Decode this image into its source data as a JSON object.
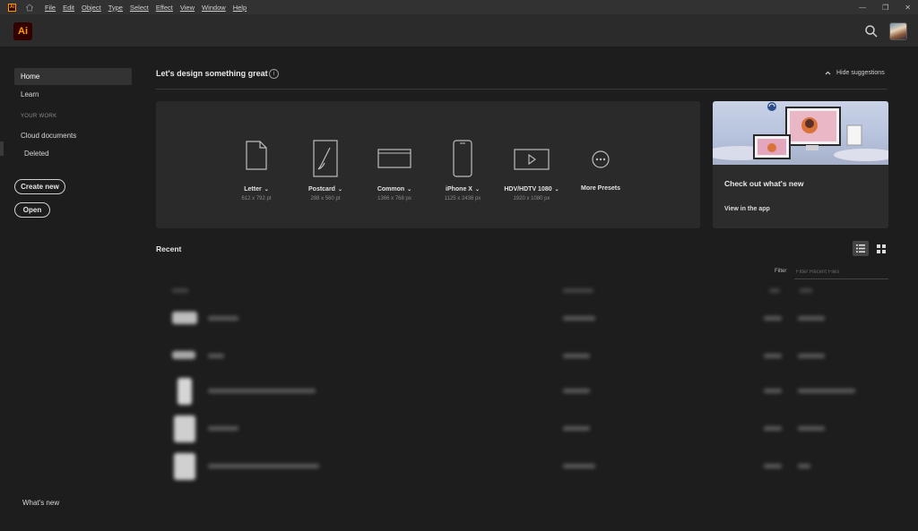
{
  "menubar": {
    "app_badge": "Ai",
    "items": [
      "File",
      "Edit",
      "Object",
      "Type",
      "Select",
      "Effect",
      "View",
      "Window",
      "Help"
    ],
    "window_controls": [
      "—",
      "❐",
      "✕"
    ]
  },
  "header": {
    "logo_text": "Ai",
    "brand_color": "#ff9a00"
  },
  "sidebar": {
    "home": "Home",
    "learn": "Learn",
    "section_label": "YOUR WORK",
    "cloud_documents": "Cloud documents",
    "deleted": "Deleted",
    "create_new": "Create new",
    "open": "Open",
    "whats_new": "What's new"
  },
  "main": {
    "title": "Let's design something great",
    "hide_suggestions": "Hide suggestions",
    "presets": [
      {
        "name": "Letter",
        "size": "612 x 792 pt",
        "icon": "document-icon",
        "dropdown": true
      },
      {
        "name": "Postcard",
        "size": "288 x 560 pt",
        "icon": "brush-icon",
        "dropdown": true
      },
      {
        "name": "Common",
        "size": "1366 x 768 px",
        "icon": "browser-icon",
        "dropdown": true
      },
      {
        "name": "iPhone X",
        "size": "1125 x 2436 px",
        "icon": "phone-icon",
        "dropdown": true
      },
      {
        "name": "HDV/HDTV 1080",
        "size": "1920 x 1080 px",
        "icon": "video-icon",
        "dropdown": true
      },
      {
        "name": "More Presets",
        "size": "",
        "icon": "more-icon",
        "dropdown": false
      }
    ],
    "promo": {
      "title": "Check out what's new",
      "link": "View in the app"
    },
    "recent": {
      "title": "Recent",
      "filter_label": "Filter",
      "filter_placeholder": "Filter Recent Files"
    }
  }
}
